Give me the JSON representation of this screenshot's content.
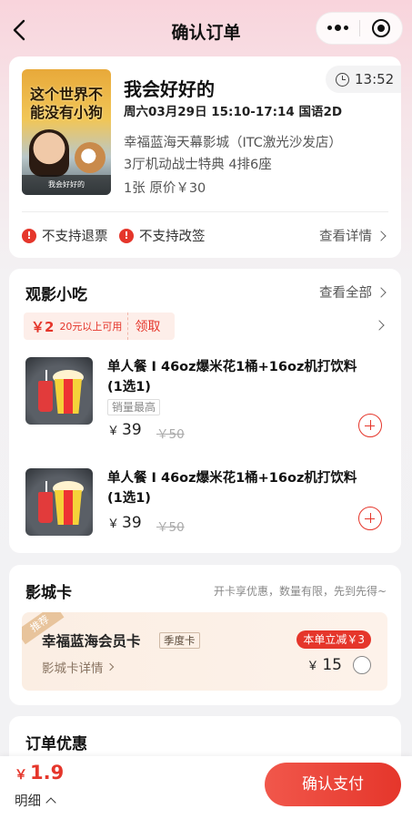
{
  "header": {
    "title": "确认订单",
    "back_icon": "chevron-left-icon",
    "more_icon": "more-dots-icon",
    "close_icon": "target-close-icon"
  },
  "movie": {
    "poster_text": "这个世界不能没有小狗",
    "title": "我会好好的",
    "countdown": "13:52",
    "show_time": "周六03月29日 15:10-17:14 国语2D",
    "cinema": "幸福蓝海天幕影城（ITC激光沙发店）",
    "hall_seat": "3厅机动战士特典  4排6座",
    "ticket": "1张  原价￥30",
    "policy_no_refund": "不支持退票",
    "policy_no_change": "不支持改签",
    "detail_link": "查看详情"
  },
  "snacks": {
    "title": "观影小吃",
    "view_all": "查看全部",
    "coupon": {
      "amount": "￥2",
      "condition": "20元以上可用",
      "claim": "领取"
    },
    "items": [
      {
        "name": "单人餐 I 46oz爆米花1桶+16oz机打饮料(1选1)",
        "tag": "销量最高",
        "currency": "￥",
        "price": "39",
        "original": "￥50"
      },
      {
        "name": "单人餐 I 46oz爆米花1桶+16oz机打饮料(1选1)",
        "currency": "￥",
        "price": "39",
        "original": "￥50"
      }
    ]
  },
  "cinema_card": {
    "title": "影城卡",
    "tip": "开卡享优惠，数量有限，先到先得~",
    "recommend_badge": "推荐",
    "card_name": "幸福蓝海会员卡",
    "card_type": "季度卡",
    "detail_link": "影城卡详情",
    "discount_badge": "本单立减￥3",
    "currency": "￥",
    "price": "15"
  },
  "order_discount": {
    "title": "订单优惠"
  },
  "bottom": {
    "currency": "￥",
    "total": "1.9",
    "detail_toggle": "明细",
    "pay_button": "确认支付"
  },
  "colors": {
    "accent": "#e5362b",
    "member_bg": "#fbeee3"
  }
}
